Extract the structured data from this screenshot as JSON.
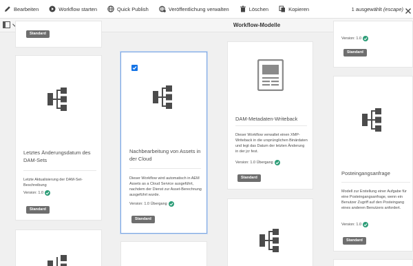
{
  "actionbar": {
    "edit": "Bearbeiten",
    "start_workflow": "Workflow starten",
    "quick_publish": "Quick Publish",
    "manage_publication": "Veröffentlichung verwalten",
    "delete": "Löschen",
    "copy": "Kopieren",
    "selected_count": "1 ausgewählt",
    "escape_hint": "(escape)"
  },
  "titlebar": {
    "title": "Workflow-Modelle"
  },
  "cards": {
    "c1": {
      "button": "Standard"
    },
    "c2": {
      "title": "Letztes Änderungsdatum des DAM-Sets",
      "desc": "Letzte Aktualisierung der DAM-Set-Beschreibung",
      "version": "Version: 1.0",
      "button": "Standard"
    },
    "c3": {
      "title": "Nachbearbeitung von Assets in der Cloud",
      "desc": "Dieser Workflow wird automatisch in AEM Assets as a Cloud Service ausgeführt, nachdem der Dienst zur Asset-Berechnung ausgeführt wurde.",
      "version": "Version: 1.0 Übergang",
      "button": "Standard"
    },
    "c4": {
      "title": "DAM-Metadaten-Writeback",
      "desc": "Dieser Workflow verwaltet einen XMP-Writeback in die ursprünglichen Binärdaten und legt das Datum der letzten Änderung in der jcr fest.",
      "version": "Version: 1.0 Übergang",
      "button": "Standard"
    },
    "c5": {
      "version": "Version: 1.0",
      "button": "Standard"
    },
    "c6": {
      "title": "Posteingangsanfrage",
      "desc": "Modell zur Erstellung einer Aufgabe für eine Posteingangsanfrage, wenn ein Benutzer Zugriff auf den Posteingang eines anderen Benutzers anfordert.",
      "version": "Version: 1.0",
      "button": "Standard"
    }
  },
  "colors": {
    "accent": "#1473e6",
    "success": "#2d9d78",
    "button": "#6e6e6e"
  }
}
